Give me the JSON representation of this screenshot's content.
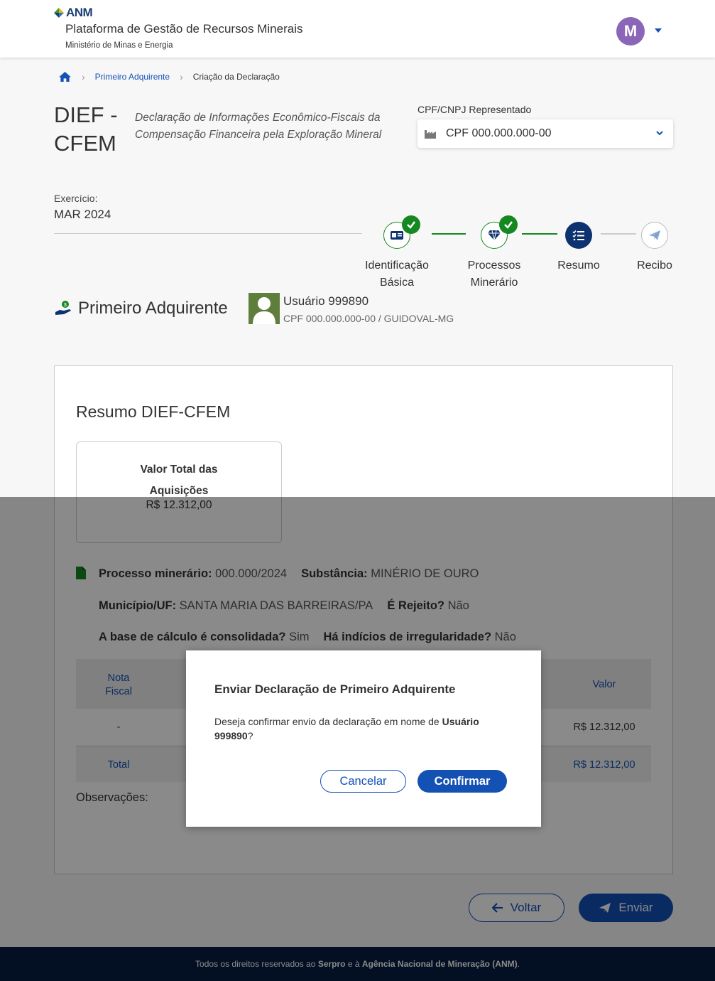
{
  "header": {
    "logo_text": "ANM",
    "platform_title": "Plataforma de Gestão de Recursos Minerais",
    "ministry": "Ministério de Minas e Energia",
    "avatar_letter": "M"
  },
  "breadcrumb": {
    "items": [
      "Primeiro Adquirente",
      "Criação da Declaração"
    ]
  },
  "page": {
    "title": "DIEF - CFEM",
    "subtitle": "Declaração de Informações Econômico-Fiscais da Compensação Financeira pela Exploração Mineral",
    "cpf_label": "CPF/CNPJ Representado",
    "cpf_value": "CPF 000.000.000-00",
    "exercise_label": "Exercício:",
    "exercise_value": "MAR 2024"
  },
  "stepper": {
    "steps": [
      {
        "label_1": "Identificação",
        "label_2": "Básica",
        "state": "done",
        "icon": "id-card-icon"
      },
      {
        "label_1": "Processos",
        "label_2": "Minerário",
        "state": "done",
        "icon": "diamond-icon"
      },
      {
        "label_1": "Resumo",
        "label_2": "",
        "state": "active",
        "icon": "list-check-icon"
      },
      {
        "label_1": "Recibo",
        "label_2": "",
        "state": "idle",
        "icon": "paper-plane-icon"
      }
    ],
    "colors": {
      "done": "#168821",
      "active": "#0c326f",
      "idle": "#bbbbbb"
    }
  },
  "acquirer": {
    "section_title": "Primeiro Adquirente",
    "user_name": "Usuário 999890",
    "user_info": "CPF 000.000.000-00 / GUIDOVAL-MG"
  },
  "summary": {
    "title": "Resumo DIEF-CFEM",
    "total_label": "Valor Total das Aquisições",
    "total_value": "R$ 12.312,00",
    "process": {
      "process_label": "Processo minerário:",
      "process_value": "000.000/2024",
      "substance_label": "Substância:",
      "substance_value": "MINÉRIO DE OURO",
      "municipality_label": "Município/UF:",
      "municipality_value": "SANTA MARIA DAS BARREIRAS/PA",
      "reject_label": "É Rejeito?",
      "reject_value": "Não",
      "base_label": "A base de cálculo é consolidada?",
      "base_value": "Sim",
      "irregular_label": "Há indícios de irregularidade?",
      "irregular_value": "Não"
    },
    "table": {
      "col_nf_1": "Nota",
      "col_nf_2": "Fiscal",
      "col_value": "Valor",
      "row_nf": "-",
      "row_value": "R$ 12.312,00",
      "total_label": "Total",
      "total_value": "R$ 12.312,00"
    },
    "observations_label": "Observações:"
  },
  "actions": {
    "back_label": "Voltar",
    "send_label": "Enviar"
  },
  "footer": {
    "prefix": "Todos os direitos reservados ao",
    "serpro": "Serpro",
    "middle": "e à",
    "anm": "Agência Nacional de Mineração (ANM)",
    "suffix": "."
  },
  "modal": {
    "title": "Enviar Declaração de Primeiro Adquirente",
    "body_prefix": "Deseja confirmar envio da declaração em nome de",
    "body_user": "Usuário 999890",
    "body_suffix": "?",
    "cancel_label": "Cancelar",
    "confirm_label": "Confirmar"
  }
}
